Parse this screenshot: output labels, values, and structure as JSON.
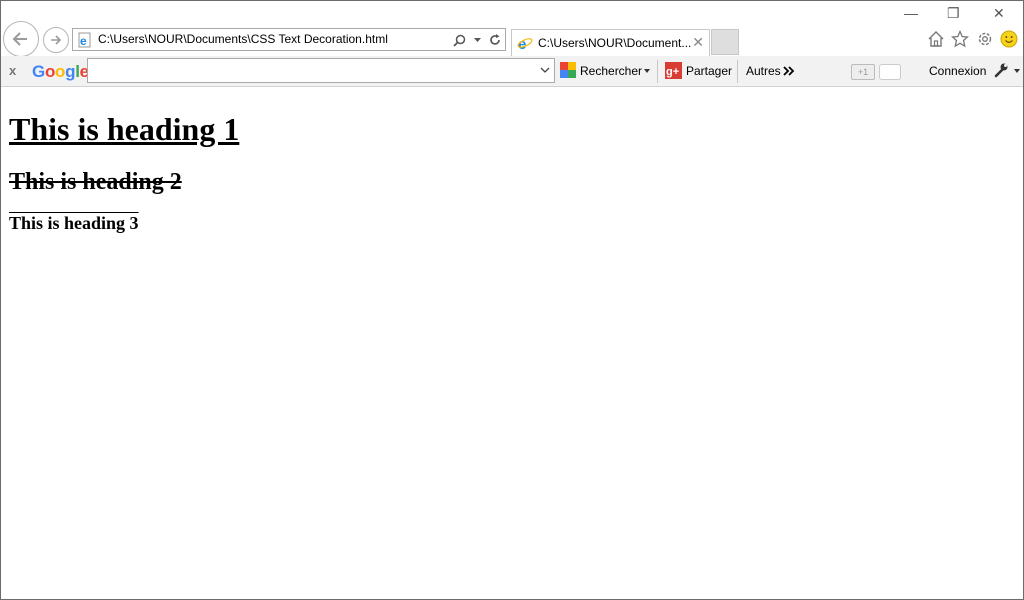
{
  "window": {
    "minimize_glyph": "—",
    "restore_glyph": "❐",
    "close_glyph": "✕"
  },
  "navigation": {
    "back_icon": "back-arrow-icon",
    "forward_icon": "forward-arrow-icon"
  },
  "address_bar": {
    "url": "C:\\Users\\NOUR\\Documents\\CSS Text Decoration.html",
    "search_icon": "search-icon",
    "dropdown_icon": "chevron-down-icon",
    "refresh_icon": "refresh-icon"
  },
  "tab": {
    "title": "C:\\Users\\NOUR\\Document...",
    "close_glyph": "✕"
  },
  "google_toolbar": {
    "close_glyph": "x",
    "logo_letters": [
      "G",
      "o",
      "o",
      "g",
      "l",
      "e"
    ],
    "search_value": "",
    "rechercher_label": "Rechercher",
    "partager_label": "Partager",
    "autres_label": "Autres",
    "gplus_label": "+1",
    "connexion_label": "Connexion"
  },
  "page": {
    "heading1": "This is heading 1",
    "heading2": "This is heading 2",
    "heading3": "This is heading 3"
  },
  "colors": {
    "google_blue": "#4285f4",
    "google_red": "#ea4335",
    "google_yellow": "#fbbc05",
    "google_green": "#34a853",
    "ie_blue": "#1e88e5",
    "smiley_yellow": "#f7d21a"
  }
}
